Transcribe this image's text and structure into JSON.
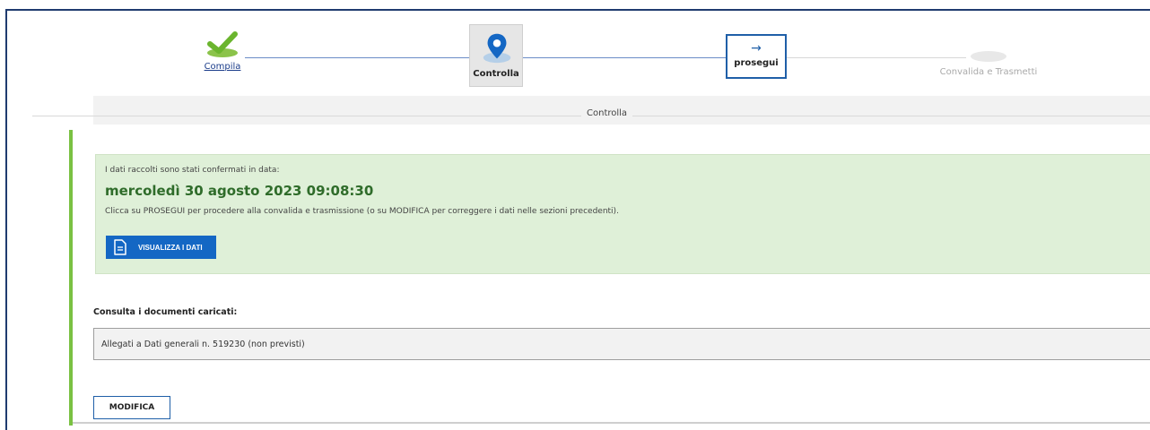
{
  "stepper": {
    "steps": [
      {
        "label": "Compila",
        "state": "done"
      },
      {
        "label": "Controlla",
        "state": "active"
      },
      {
        "label": "prosegui",
        "state": "action"
      },
      {
        "label": "Convalida e Trasmetti",
        "state": "pending"
      }
    ],
    "prosegui_arrow": "→",
    "icons": {
      "done": "check-icon",
      "active": "map-pin-icon",
      "action": "arrow-right-icon"
    }
  },
  "section": {
    "title": "Controlla"
  },
  "confirmation": {
    "intro": "I dati raccolti sono stati confermati in data:",
    "date": "mercoledì 30 agosto 2023 09:08:30",
    "help": "Clicca su PROSEGUI per procedere alla convalida e trasmissione (o su MODIFICA per correggere i dati nelle sezioni precedenti).",
    "view_button": "VISUALIZZA I DATI"
  },
  "documents": {
    "label": "Consulta i documenti caricati:",
    "items": [
      "Allegati a Dati generali n. 519230 (non previsti)"
    ]
  },
  "actions": {
    "modify_button": "MODIFICA"
  },
  "colors": {
    "accent_blue": "#1467c4",
    "success_green": "#7ac142",
    "confirm_bg": "#dff0d8",
    "date_green": "#2f6c2a"
  }
}
